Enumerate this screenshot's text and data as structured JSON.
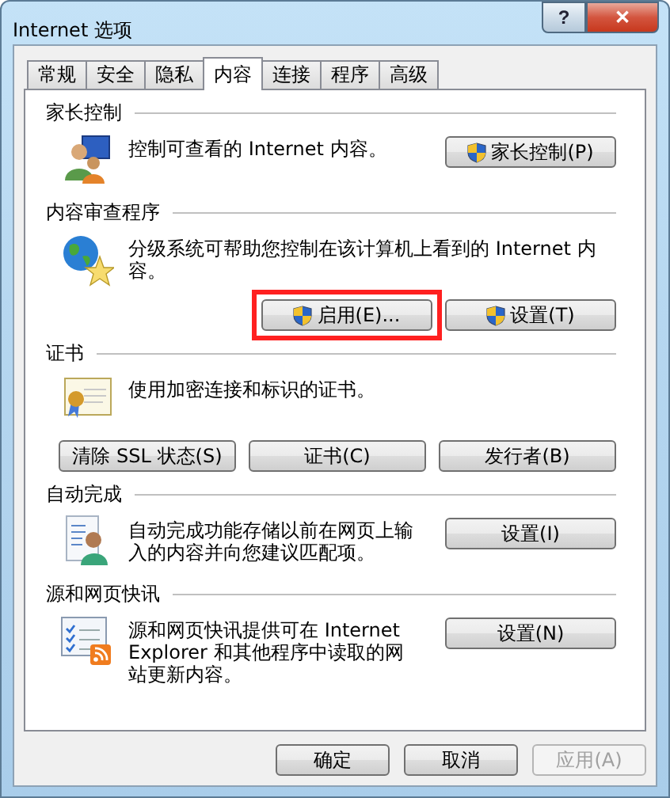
{
  "window": {
    "title": "Internet 选项",
    "help": "?",
    "close": "✕"
  },
  "tabs": [
    {
      "label": "常规",
      "selected": false
    },
    {
      "label": "安全",
      "selected": false
    },
    {
      "label": "隐私",
      "selected": false
    },
    {
      "label": "内容",
      "selected": true
    },
    {
      "label": "连接",
      "selected": false
    },
    {
      "label": "程序",
      "selected": false
    },
    {
      "label": "高级",
      "selected": false
    }
  ],
  "sections": [
    {
      "title": "家长控制",
      "kind": "inline",
      "description": "控制可查看的 Internet 内容。",
      "buttons": [
        {
          "label": "家长控制(P)",
          "shield": true,
          "highlighted": false
        }
      ]
    },
    {
      "title": "内容审查程序",
      "kind": "stacked",
      "description": "分级系统可帮助您控制在该计算机上看到的 Internet 内容。",
      "buttons": [
        {
          "label": "启用(E)...",
          "shield": true,
          "highlighted": true
        },
        {
          "label": "设置(T)",
          "shield": true,
          "highlighted": false
        }
      ]
    },
    {
      "title": "证书",
      "kind": "stacked",
      "description": "使用加密连接和标识的证书。",
      "buttons": [
        {
          "label": "清除 SSL 状态(S)",
          "shield": false,
          "highlighted": false
        },
        {
          "label": "证书(C)",
          "shield": false,
          "highlighted": false
        },
        {
          "label": "发行者(B)",
          "shield": false,
          "highlighted": false
        }
      ]
    },
    {
      "title": "自动完成",
      "kind": "inline",
      "description": "自动完成功能存储以前在网页上输入的内容并向您建议匹配项。",
      "buttons": [
        {
          "label": "设置(I)",
          "shield": false,
          "highlighted": false
        }
      ]
    },
    {
      "title": "源和网页快讯",
      "kind": "inline",
      "description": "源和网页快讯提供可在 Internet Explorer 和其他程序中读取的网站更新内容。",
      "buttons": [
        {
          "label": "设置(N)",
          "shield": false,
          "highlighted": false
        }
      ]
    }
  ],
  "footer": [
    {
      "label": "确定",
      "disabled": false
    },
    {
      "label": "取消",
      "disabled": false
    },
    {
      "label": "应用(A)",
      "disabled": true
    }
  ]
}
